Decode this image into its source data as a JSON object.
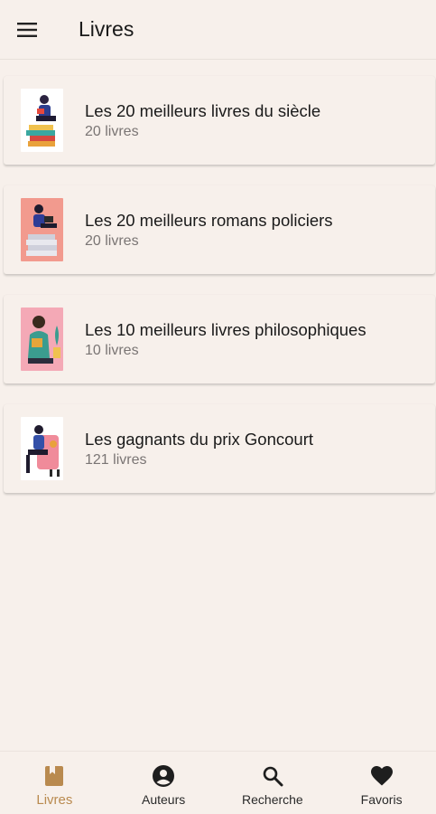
{
  "header": {
    "title": "Livres",
    "menu_icon": "hamburger-menu-icon"
  },
  "lists": [
    {
      "title": "Les 20 meilleurs livres du siècle",
      "count": "20 livres"
    },
    {
      "title": "Les 20 meilleurs romans policiers",
      "count": "20 livres"
    },
    {
      "title": "Les 10 meilleurs livres philosophiques",
      "count": "10 livres"
    },
    {
      "title": "Les gagnants du prix Goncourt",
      "count": "121 livres"
    }
  ],
  "bottom_nav": [
    {
      "label": "Livres",
      "icon": "book-icon",
      "active": true
    },
    {
      "label": "Auteurs",
      "icon": "account-circle-icon",
      "active": false
    },
    {
      "label": "Recherche",
      "icon": "search-icon",
      "active": false
    },
    {
      "label": "Favoris",
      "icon": "heart-icon",
      "active": false
    }
  ],
  "colors": {
    "background": "#f7f0eb",
    "accent": "#b98a4f",
    "text": "#1a1a1a",
    "subtext": "#7a7574"
  }
}
